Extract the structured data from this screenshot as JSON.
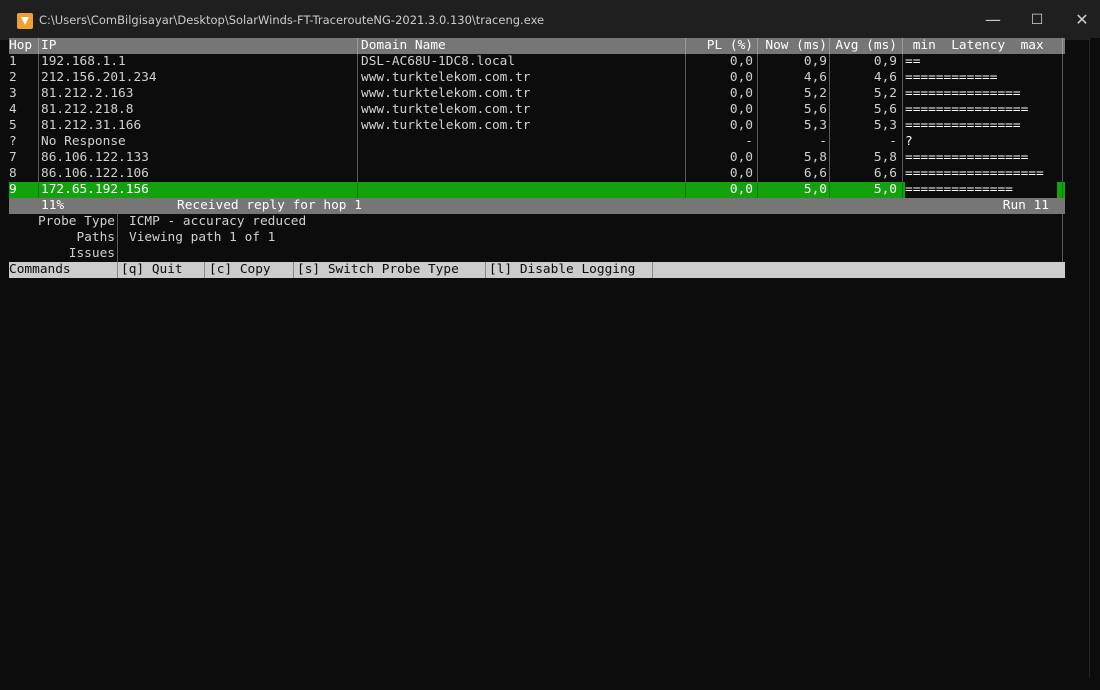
{
  "window": {
    "title": "C:\\Users\\ComBilgisayar\\Desktop\\SolarWinds-FT-TracerouteNG-2021.3.0.130\\traceng.exe",
    "minimize": "—",
    "maximize": "☐",
    "close": "✕"
  },
  "table": {
    "headers": {
      "hop": "Hop",
      "ip": "IP",
      "domain": "Domain Name",
      "pl": "PL (%)",
      "now": "Now (ms)",
      "avg": "Avg (ms)",
      "latency": " min  Latency  max"
    },
    "rows": [
      {
        "hop": "1",
        "ip": "192.168.1.1",
        "domain": "DSL-AC68U-1DC8.local",
        "pl": "0,0",
        "now": "0,9",
        "avg": "0,9",
        "bar": "=="
      },
      {
        "hop": "2",
        "ip": "212.156.201.234",
        "domain": "www.turktelekom.com.tr",
        "pl": "0,0",
        "now": "4,6",
        "avg": "4,6",
        "bar": "============"
      },
      {
        "hop": "3",
        "ip": "81.212.2.163",
        "domain": "www.turktelekom.com.tr",
        "pl": "0,0",
        "now": "5,2",
        "avg": "5,2",
        "bar": "==============="
      },
      {
        "hop": "4",
        "ip": "81.212.218.8",
        "domain": "www.turktelekom.com.tr",
        "pl": "0,0",
        "now": "5,6",
        "avg": "5,6",
        "bar": "================"
      },
      {
        "hop": "5",
        "ip": "81.212.31.166",
        "domain": "www.turktelekom.com.tr",
        "pl": "0,0",
        "now": "5,3",
        "avg": "5,3",
        "bar": "==============="
      },
      {
        "hop": "?",
        "ip": "No Response",
        "domain": "",
        "pl": "-",
        "now": "-",
        "avg": "-",
        "bar": "?"
      },
      {
        "hop": "7",
        "ip": "86.106.122.133",
        "domain": "",
        "pl": "0,0",
        "now": "5,8",
        "avg": "5,8",
        "bar": "================"
      },
      {
        "hop": "8",
        "ip": "86.106.122.106",
        "domain": "",
        "pl": "0,0",
        "now": "6,6",
        "avg": "6,6",
        "bar": "=================="
      },
      {
        "hop": "9",
        "ip": "172.65.192.156",
        "domain": "",
        "pl": "0,0",
        "now": "5,0",
        "avg": "5,0",
        "bar": "=============="
      }
    ]
  },
  "status": {
    "percent": "11%",
    "message": "Received reply for hop 1",
    "run": "Run 11"
  },
  "info": {
    "probe_label": "Probe Type",
    "probe_value": "ICMP - accuracy reduced",
    "paths_label": "Paths",
    "paths_value": "Viewing path 1 of 1",
    "issues_label": "Issues",
    "issues_value": ""
  },
  "commands": {
    "label": "Commands",
    "quit": "[q] Quit",
    "copy": "[c] Copy",
    "switch": "[s] Switch Probe Type",
    "logging": "[l] Disable Logging"
  },
  "colors": {
    "selected_row": "#13a10e",
    "header_bg": "#767676",
    "command_bar_bg": "#cccccc"
  }
}
